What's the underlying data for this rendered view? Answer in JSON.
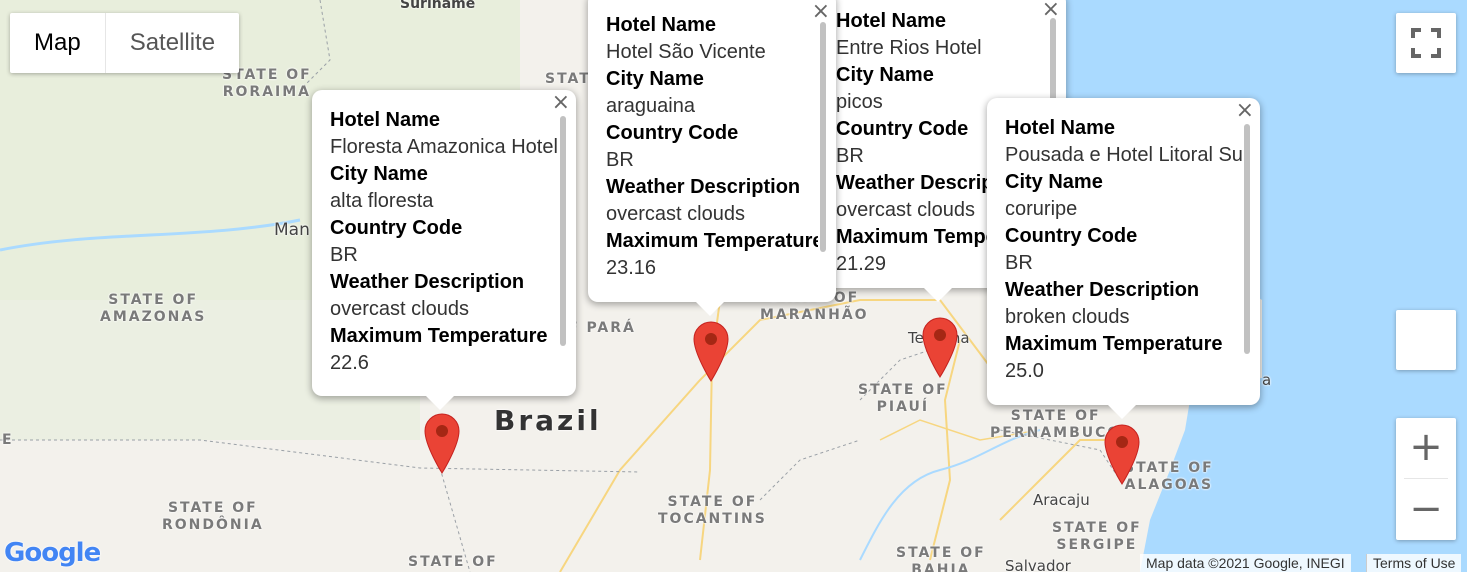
{
  "map_type": {
    "map": "Map",
    "satellite": "Satellite",
    "selected": "Map"
  },
  "labels": {
    "suriname": "Suriname",
    "roraima": "STATE OF\nRORAIMA",
    "state_top": "STATE",
    "manaus": "Man",
    "amazonas": "STATE OF\nAMAZONAS",
    "para": "F PARÁ",
    "maranhao": "STATE OF\nMARANHÃO",
    "teresina": "Teresina",
    "piaui": "STATE OF\nPIAUÍ",
    "pernambuco": "STATE OF\nPERNAMBUCO",
    "alagoas": "STATE OF\nALAGOAS",
    "brazil": "Brazil",
    "tocantins": "STATE OF\nTOCANTINS",
    "rondonia": "STATE OF\nRONDÔNIA",
    "state_of_bottom": "STATE OF",
    "bahia": "STATE OF\nBAHIA",
    "aracaju": "Aracaju",
    "sergipe": "STATE OF\nSERGIPE",
    "salvador": "Salvador",
    "edge_e": "E",
    "edge_a": "a"
  },
  "field_labels": {
    "hotel": "Hotel Name",
    "city": "City Name",
    "country": "Country Code",
    "weather": "Weather Description",
    "temp": "Maximum Temperature"
  },
  "field_labels_truncated": {
    "weather": "Weather Descript",
    "temp": "Maximum Tempe"
  },
  "hotels": [
    {
      "hotel": "Floresta Amazonica Hotel",
      "city": "alta floresta",
      "country": "BR",
      "weather": "overcast clouds",
      "temp": "22.6"
    },
    {
      "hotel": "Hotel São Vicente",
      "city": "araguaina",
      "country": "BR",
      "weather": "overcast clouds",
      "temp": "23.16"
    },
    {
      "hotel": "Entre Rios Hotel",
      "city": "picos",
      "country": "BR",
      "weather": "overcast clouds",
      "temp": "21.29"
    },
    {
      "hotel": "Pousada e Hotel Litoral Sul",
      "city": "coruripe",
      "country": "BR",
      "weather": "broken clouds",
      "temp": "25.0"
    }
  ],
  "controls": {
    "fullscreen": "fullscreen-icon",
    "zoom_in": "+",
    "zoom_out": "−",
    "close": "×"
  },
  "footer": {
    "logo": "Google",
    "attribution": "Map data ©2021 Google, INEGI",
    "terms": "Terms of Use"
  },
  "colors": {
    "water": "#aadaff",
    "land": "#f3f1ec",
    "marker": "#ea4335",
    "marker_dot": "#a52714"
  }
}
